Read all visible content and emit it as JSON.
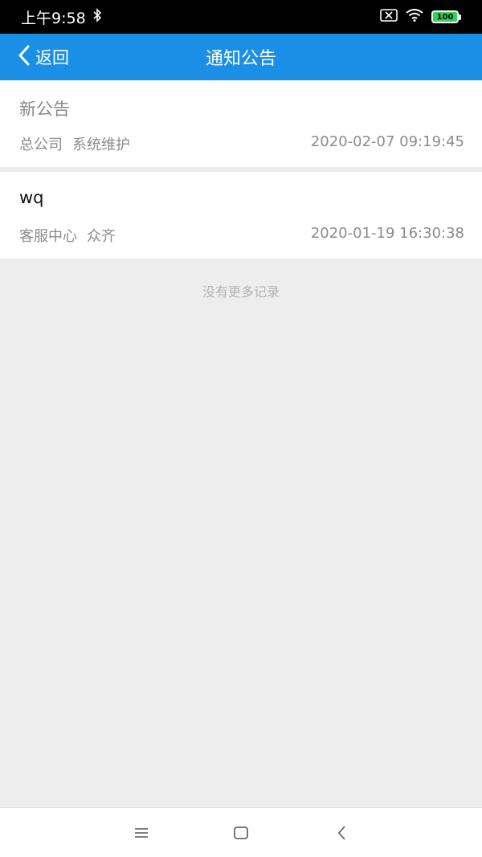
{
  "status_bar": {
    "time": "上午9:58",
    "battery": "100",
    "icons": [
      "bluetooth-icon",
      "sim-off-icon",
      "wifi-icon",
      "battery-icon"
    ]
  },
  "header": {
    "back_label": "返回",
    "title": "通知公告"
  },
  "notices": [
    {
      "title": "新公告",
      "department": "总公司",
      "author": "系统维护",
      "time": "2020-02-07 09:19:45"
    },
    {
      "title": "wq",
      "department": "客服中心",
      "author": "众齐",
      "time": "2020-01-19 16:30:38"
    }
  ],
  "footer_text": "没有更多记录",
  "system_nav": [
    "menu-icon",
    "home-icon",
    "back-icon"
  ],
  "colors": {
    "accent": "#1b8fe6",
    "battery": "#2fd35a",
    "background": "#ededed"
  }
}
